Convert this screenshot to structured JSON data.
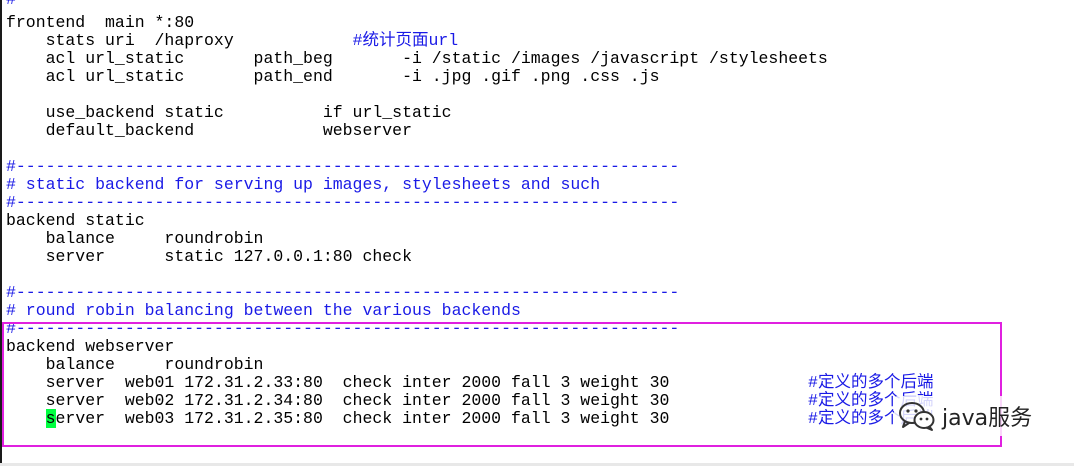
{
  "terminal": {
    "lines": [
      {
        "text": "#-------------------------------------------------------------------",
        "kind": "comment"
      },
      {
        "text": "frontend  main *:80",
        "kind": "code"
      },
      {
        "text": "    stats uri  /haproxy",
        "kind": "code",
        "trail": "            #统计页面url"
      },
      {
        "text": "    acl url_static       path_beg       -i /static /images /javascript /stylesheets",
        "kind": "code"
      },
      {
        "text": "    acl url_static       path_end       -i .jpg .gif .png .css .js",
        "kind": "code"
      },
      {
        "text": "",
        "kind": "code"
      },
      {
        "text": "    use_backend static          if url_static",
        "kind": "code"
      },
      {
        "text": "    default_backend             webserver",
        "kind": "code"
      },
      {
        "text": "",
        "kind": "code"
      },
      {
        "text": "#-------------------------------------------------------------------",
        "kind": "comment"
      },
      {
        "text": "# static backend for serving up images, stylesheets and such",
        "kind": "comment"
      },
      {
        "text": "#-------------------------------------------------------------------",
        "kind": "comment"
      },
      {
        "text": "backend static",
        "kind": "code"
      },
      {
        "text": "    balance     roundrobin",
        "kind": "code"
      },
      {
        "text": "    server      static 127.0.0.1:80 check",
        "kind": "code"
      },
      {
        "text": "",
        "kind": "code"
      },
      {
        "text": "#-------------------------------------------------------------------",
        "kind": "comment"
      },
      {
        "text": "# round robin balancing between the various backends",
        "kind": "comment"
      },
      {
        "text": "#-------------------------------------------------------------------",
        "kind": "comment"
      },
      {
        "text": "backend webserver",
        "kind": "code"
      },
      {
        "text": "    balance     roundrobin",
        "kind": "code"
      },
      {
        "text": "    server  web01 172.31.2.33:80  check inter 2000 fall 3 weight 30",
        "kind": "code",
        "trail": "              #定义的多个后端"
      },
      {
        "text": "    server  web02 172.31.2.34:80  check inter 2000 fall 3 weight 30",
        "kind": "code",
        "trail": "              #定义的多个后端"
      },
      {
        "text": "erver  web03 172.31.2.35:80  check inter 2000 fall 3 weight 30",
        "kind": "code",
        "cursor_char": "s",
        "indent": "    ",
        "trail": "              #定义的多个后端"
      }
    ]
  },
  "watermark": {
    "text": "java服务",
    "icon": "wechat-icon"
  },
  "colors": {
    "comment": "#1a1ae6",
    "cursor": "#00ff40",
    "highlight": "#e020e0"
  }
}
